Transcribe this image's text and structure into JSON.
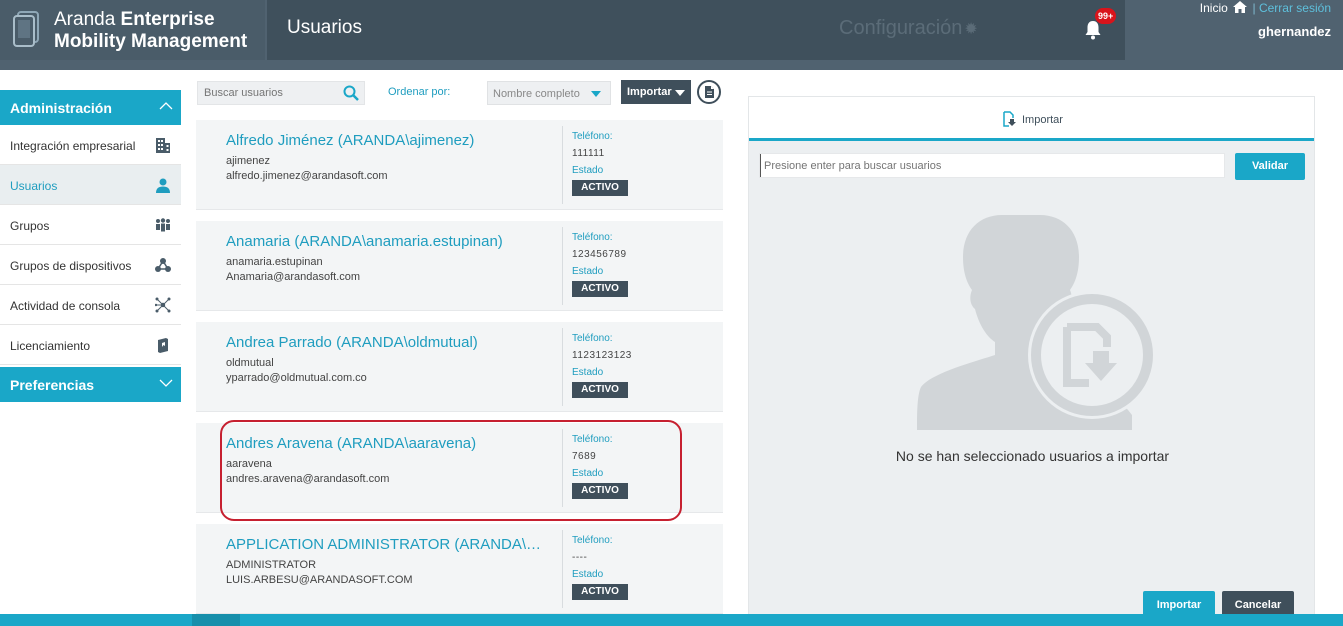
{
  "brand": {
    "light": "Aranda ",
    "bold_line1": "Enterprise",
    "line2": "Mobility Management"
  },
  "header": {
    "page_title": "Usuarios",
    "config_label": "Configuración",
    "notifications_badge": "99+",
    "home_label": "Inicio",
    "separator": "|",
    "logout_label": "Cerrar sesión",
    "username": "ghernandez"
  },
  "sidebar": {
    "admin_header": "Administración",
    "items": [
      {
        "label": "Integración empresarial",
        "icon": "building-icon"
      },
      {
        "label": "Usuarios",
        "icon": "user-icon"
      },
      {
        "label": "Grupos",
        "icon": "group-icon"
      },
      {
        "label": "Grupos de dispositivos",
        "icon": "device-groups-icon"
      },
      {
        "label": "Actividad de consola",
        "icon": "network-icon"
      },
      {
        "label": "Licenciamiento",
        "icon": "license-icon"
      }
    ],
    "pref_header": "Preferencias"
  },
  "toolbar": {
    "search_placeholder": "Buscar usuarios",
    "order_label": "Ordenar por:",
    "order_value": "Nombre completo",
    "import_label": "Importar"
  },
  "users": [
    {
      "name": "Alfredo Jiménez (ARANDA\\ajimenez)",
      "login": "ajimenez",
      "email": "alfredo.jimenez@arandasoft.com",
      "tel_label": "Teléfono:",
      "tel": "111111",
      "state_label": "Estado",
      "state": "ACTIVO"
    },
    {
      "name": "Anamaria (ARANDA\\anamaria.estupinan)",
      "login": "anamaria.estupinan",
      "email": "Anamaria@arandasoft.com",
      "tel_label": "Teléfono:",
      "tel": "123456789",
      "state_label": "Estado",
      "state": "ACTIVO"
    },
    {
      "name": "Andrea Parrado (ARANDA\\oldmutual)",
      "login": "oldmutual",
      "email": "yparrado@oldmutual.com.co",
      "tel_label": "Teléfono:",
      "tel": "1123123123",
      "state_label": "Estado",
      "state": "ACTIVO"
    },
    {
      "name": "Andres Aravena (ARANDA\\aaravena)",
      "login": "aaravena",
      "email": "andres.aravena@arandasoft.com",
      "tel_label": "Teléfono:",
      "tel": "7689",
      "state_label": "Estado",
      "state": "ACTIVO"
    },
    {
      "name": "APPLICATION ADMINISTRATOR (ARANDA\\AD...",
      "login": "ADMINISTRATOR",
      "email": "LUIS.ARBESU@ARANDASOFT.COM",
      "tel_label": "Teléfono:",
      "tel": "----",
      "state_label": "Estado",
      "state": "ACTIVO"
    }
  ],
  "import_panel": {
    "tab_label": "Importar",
    "search_placeholder": "Presione enter para buscar usuarios",
    "validate_label": "Validar",
    "empty_message": "No se han seleccionado usuarios a importar",
    "import_button": "Importar",
    "cancel_button": "Cancelar"
  },
  "colors": {
    "accent": "#1aa7c8",
    "dark": "#3f4f5b",
    "header": "#506270",
    "alert": "#d9141b"
  }
}
